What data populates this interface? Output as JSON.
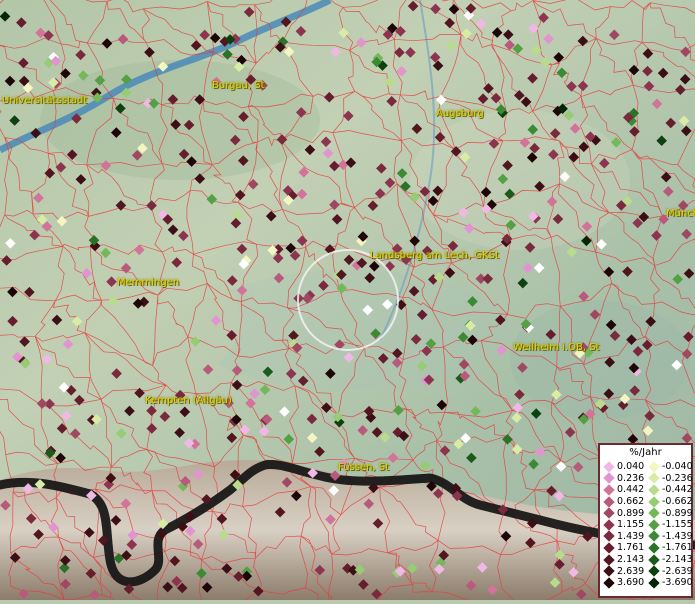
{
  "map": {
    "cities": [
      {
        "name": "Universitätsstadt"
      },
      {
        "name": "Burgau, St"
      },
      {
        "name": "Augsburg"
      },
      {
        "name": "Münch"
      },
      {
        "name": "Landsberg am Lech, GKSt"
      },
      {
        "name": "Memmingen"
      },
      {
        "name": "Weilheim i.OB, St"
      },
      {
        "name": "Kempten (Allgäu)"
      },
      {
        "name": "Füssen, St"
      }
    ]
  },
  "legend": {
    "title": "%/Jahr",
    "positive": [
      {
        "label": "0.040",
        "color": "#f0b8e4"
      },
      {
        "label": "0.236",
        "color": "#e294d0"
      },
      {
        "label": "0.442",
        "color": "#d2739a"
      },
      {
        "label": "0.662",
        "color": "#b85a7c"
      },
      {
        "label": "0.899",
        "color": "#a04862"
      },
      {
        "label": "1.155",
        "color": "#8c3450"
      },
      {
        "label": "1.439",
        "color": "#7a2a3c"
      },
      {
        "label": "1.761",
        "color": "#661e2e"
      },
      {
        "label": "2.143",
        "color": "#521620"
      },
      {
        "label": "2.639",
        "color": "#3c0e16"
      },
      {
        "label": "3.690",
        "color": "#1e0508"
      }
    ],
    "negative": [
      {
        "label": "-0.040",
        "color": "#f4f6c2"
      },
      {
        "label": "-0.236",
        "color": "#d8eca6"
      },
      {
        "label": "-0.442",
        "color": "#b8dc8c"
      },
      {
        "label": "-0.662",
        "color": "#96cc74"
      },
      {
        "label": "-0.899",
        "color": "#74b85a"
      },
      {
        "label": "-1.155",
        "color": "#54a044"
      },
      {
        "label": "-1.439",
        "color": "#3c8a34"
      },
      {
        "label": "-1.761",
        "color": "#2a7228"
      },
      {
        "label": "-2.143",
        "color": "#1c5a1c"
      },
      {
        "label": "-2.639",
        "color": "#0e4010"
      },
      {
        "label": "-3.690",
        "color": "#022606"
      }
    ]
  }
}
